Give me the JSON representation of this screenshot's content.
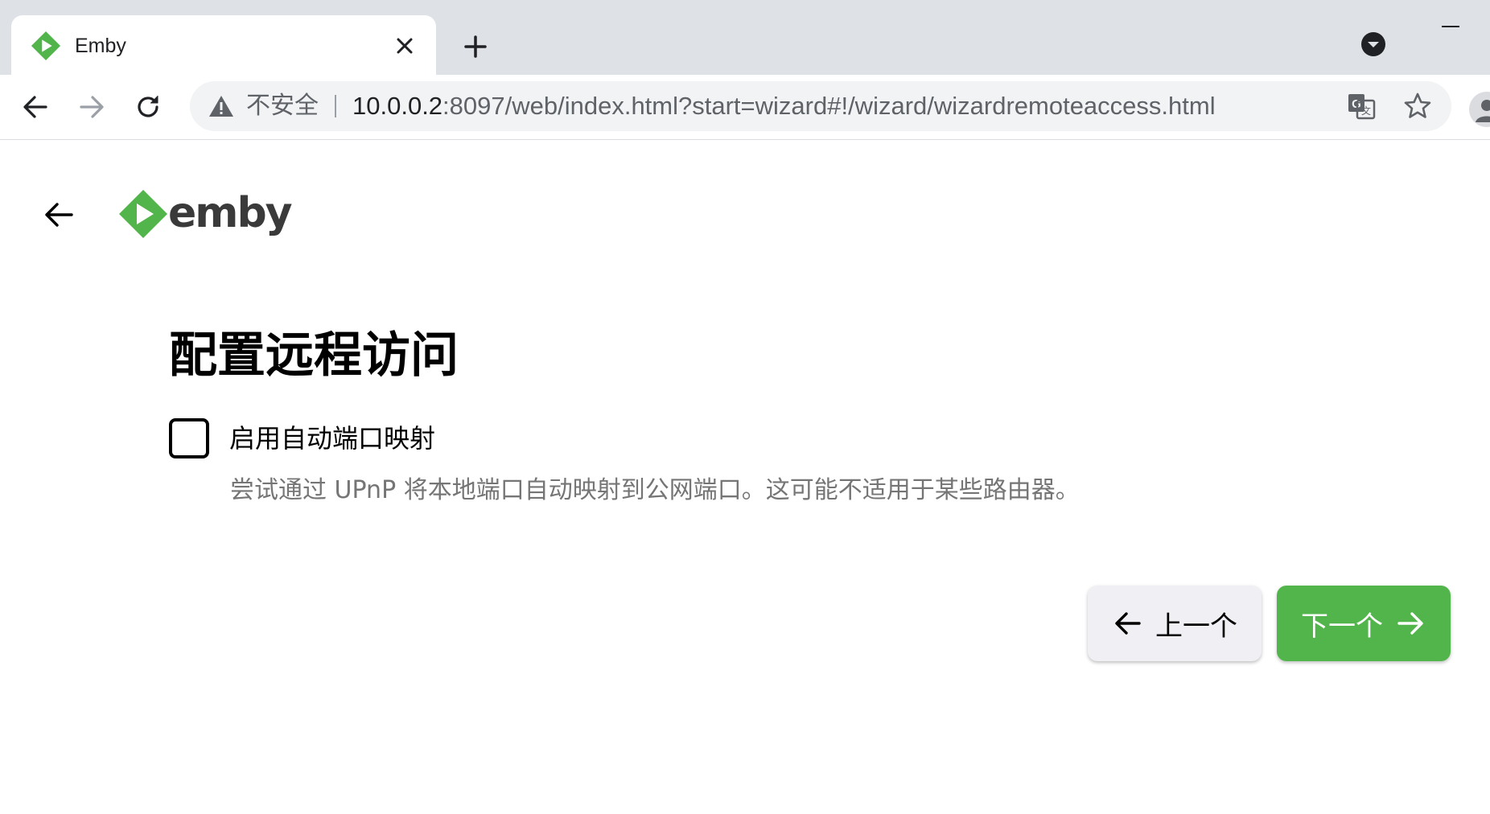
{
  "browser": {
    "tab": {
      "title": "Emby",
      "favicon": "emby-favicon"
    },
    "address_bar": {
      "security_label": "不安全",
      "url_host": "10.0.0.2",
      "url_rest": ":8097/web/index.html?start=wizard#!/wizard/wizardremoteaccess.html"
    },
    "icons": [
      "back-arrow-icon",
      "forward-arrow-icon",
      "reload-icon",
      "warning-icon",
      "translate-icon",
      "star-icon",
      "tab-search-icon",
      "profile-avatar"
    ]
  },
  "app": {
    "brand": "emby",
    "colors": {
      "accent": "#52b54b",
      "text_muted": "#757575"
    }
  },
  "wizard": {
    "title": "配置远程访问",
    "upnp": {
      "label": "启用自动端口映射",
      "checked": false,
      "description": "尝试通过 UPnP 将本地端口自动映射到公网端口。这可能不适用于某些路由器。"
    },
    "buttons": {
      "previous": "上一个",
      "next": "下一个"
    }
  }
}
